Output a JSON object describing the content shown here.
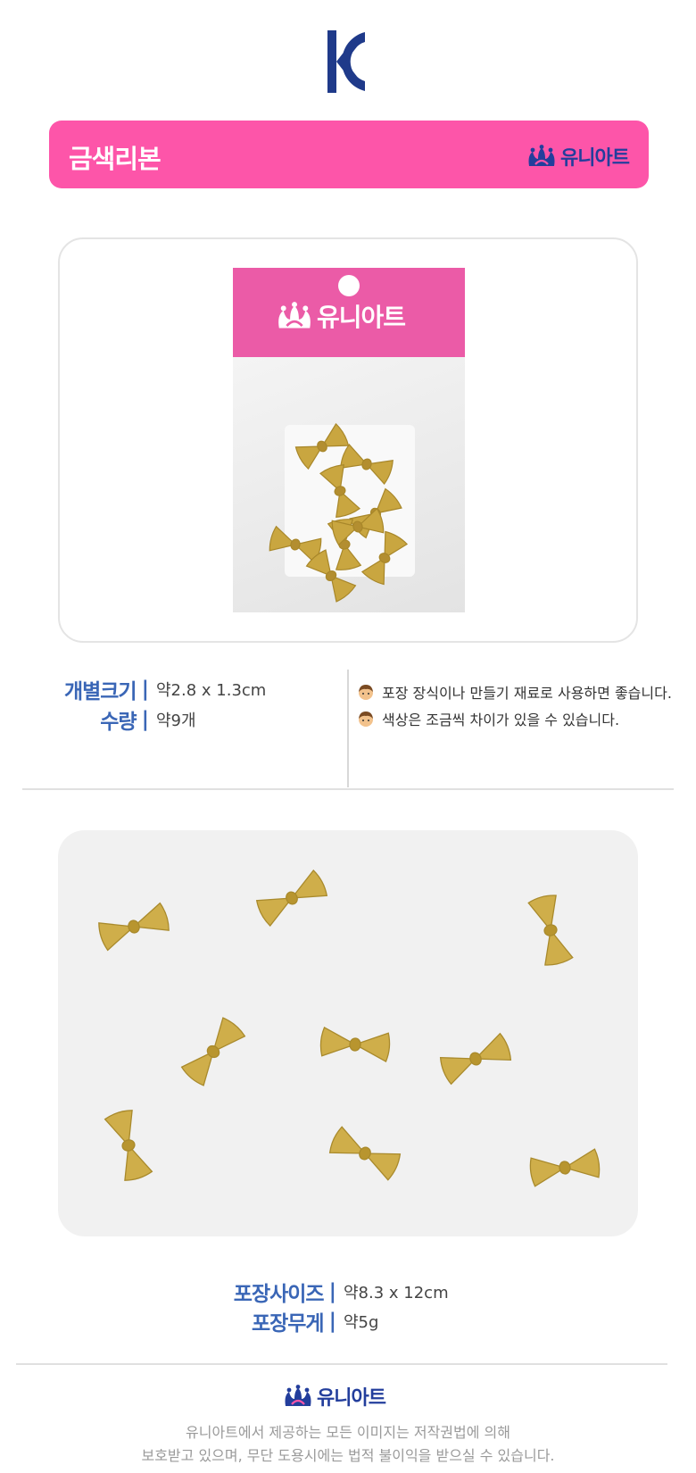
{
  "brand": {
    "name": "유니아트",
    "color_navy": "#233e9c",
    "color_pink": "#fd55a9"
  },
  "certification": {
    "icon": "kc-mark-icon",
    "color": "#1f3a8a"
  },
  "product": {
    "title": "금색리본"
  },
  "specs": {
    "size_label": "개별크기",
    "size_value": "약2.8 x 1.3cm",
    "qty_label": "수량",
    "qty_value": "약9개",
    "separator": "|"
  },
  "notes": [
    "포장 장식이나 만들기 재료로 사용하면 좋습니다.",
    "색상은 조금씩 차이가 있을 수 있습니다."
  ],
  "package_specs": {
    "size_label": "포장사이즈",
    "size_value": "약8.3 x 12cm",
    "weight_label": "포장무게",
    "weight_value": "약5g"
  },
  "footer": {
    "copyright_line1": "유니아트에서 제공하는 모든 이미지는 저작권법에 의해",
    "copyright_line2": "보호받고 있으며, 무단 도용시에는 법적 불이익을 받으실 수 있습니다."
  }
}
